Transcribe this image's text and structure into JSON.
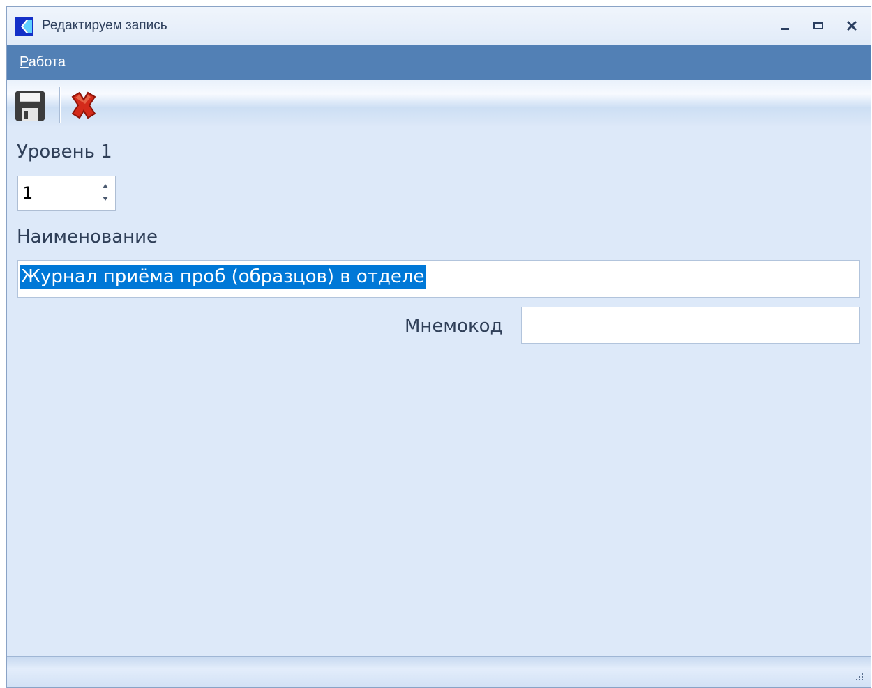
{
  "window": {
    "title": "Редактируем запись",
    "minimize_icon": "minimize-icon",
    "maximize_icon": "maximize-icon",
    "close_icon": "close-icon"
  },
  "menu": {
    "items": [
      {
        "label_accel": "Р",
        "label_rest": "абота"
      }
    ]
  },
  "toolbar": {
    "buttons": [
      {
        "icon": "floppy-disk-save-icon"
      },
      {
        "icon": "red-x-cancel-icon"
      }
    ]
  },
  "form": {
    "level_label": "Уровень 1",
    "level_value": "1",
    "name_label": "Наименование",
    "name_value": "Журнал приёма проб (образцов) в отделе",
    "mnemocode_label": "Мнемокод",
    "mnemocode_value": ""
  },
  "colors": {
    "menubar": "#5280b5",
    "window_bg": "#dde9f9",
    "selection": "#0078d7",
    "close_red": "#d42a1a"
  }
}
